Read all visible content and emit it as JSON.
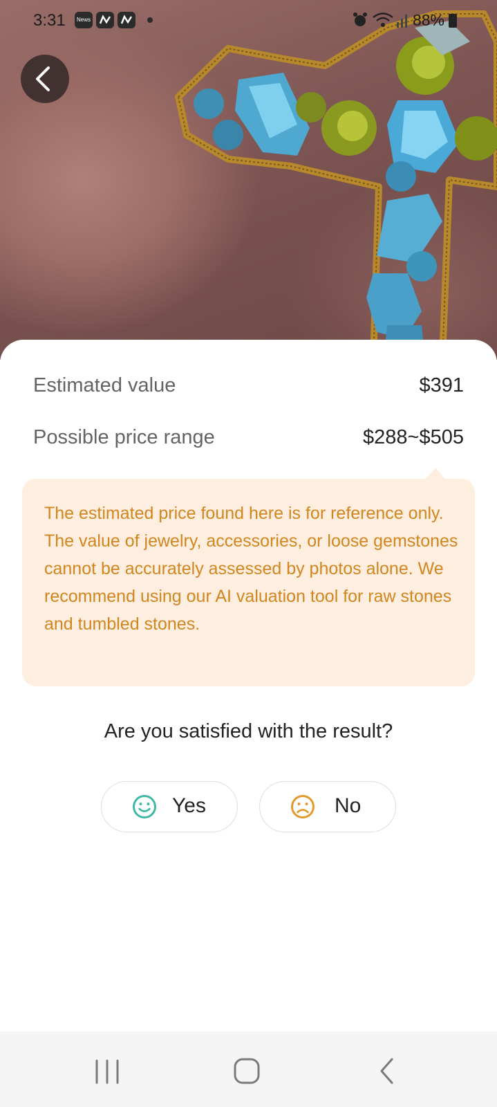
{
  "status_bar": {
    "time": "3:31",
    "notification_icons": [
      "news-icon",
      "app-icon",
      "app-icon"
    ],
    "system_icons": [
      "alarm-icon",
      "wifi-icon",
      "signal-icon"
    ],
    "battery": "88%"
  },
  "photo": {
    "subject_icon": "jewelry-photo"
  },
  "header": {
    "back_icon": "chevron-left-icon"
  },
  "valuation": {
    "estimated_label": "Estimated value",
    "estimated_value": "$391",
    "range_label": "Possible price range",
    "range_value": "$288~$505"
  },
  "notice": {
    "text": "The estimated price found here is for reference only. The value of jewelry, accessories, or loose gemstones cannot be accurately assessed by photos alone. We recommend using our AI valuation tool for raw stones and tumbled stones."
  },
  "feedback": {
    "question": "Are you satisfied with the result?",
    "yes_label": "Yes",
    "no_label": "No"
  },
  "colors": {
    "notice_bg": "#fdeee0",
    "notice_text": "#d2861f",
    "yes_icon": "#3fb8a4",
    "no_icon": "#e39a2c"
  },
  "nav_bar": {
    "icons": [
      "recents-icon",
      "home-icon",
      "back-icon"
    ]
  }
}
